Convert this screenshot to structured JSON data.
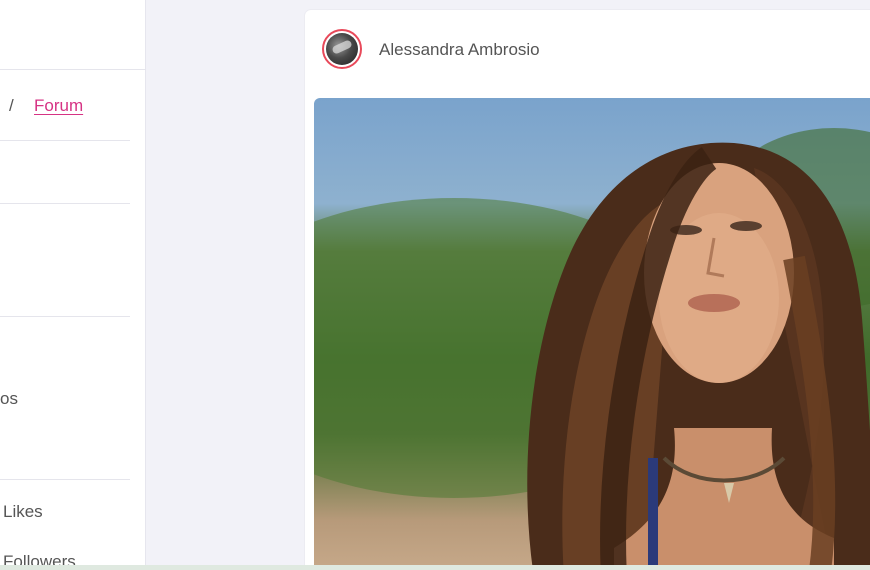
{
  "breadcrumb": {
    "separator": "/",
    "current": "Forum"
  },
  "sidebar": {
    "partial_items": [
      {
        "label": "os"
      },
      {
        "label": "Likes"
      },
      {
        "label": "Followers"
      }
    ]
  },
  "post": {
    "author": "Alessandra Ambrosio",
    "avatar_icon": "user-avatar",
    "image_icon": "photo-portrait"
  },
  "colors": {
    "accent": "#d63384",
    "avatar_ring": "#e8495a",
    "background": "#f2f2f8"
  }
}
